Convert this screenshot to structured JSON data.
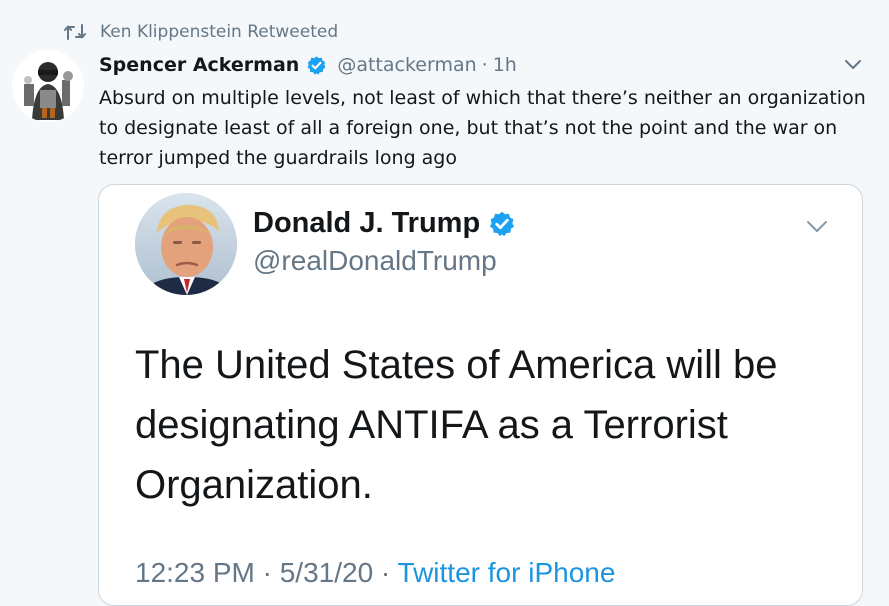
{
  "retweet_context": {
    "text": "Ken Klippenstein Retweeted",
    "icon": "retweet-icon"
  },
  "tweet": {
    "author_name": "Spencer Ackerman",
    "author_handle": "@attackerman",
    "separator": "·",
    "time": "1h",
    "text": "Absurd on multiple levels, not least of which that there’s neither an organization to designate least of all a foreign one, but that’s not the point and the war on terror jumped the guardrails long ago",
    "verified_icon": "verified-badge-icon",
    "menu_icon": "chevron-down-icon"
  },
  "embedded_tweet": {
    "author_name": "Donald J. Trump",
    "author_handle": "@realDonaldTrump",
    "text": "The United States of America will be designating ANTIFA as a Terrorist Organization.",
    "timestamp": "12:23 PM · 5/31/20 · ",
    "source": "Twitter for iPhone",
    "verified_icon": "verified-badge-icon",
    "menu_icon": "chevron-down-icon"
  },
  "colors": {
    "background": "#f5f8fa",
    "card_background": "#ffffff",
    "card_border": "#ccd6dd",
    "primary_text": "#14171a",
    "secondary_text": "#657786",
    "verified_blue": "#1da1f2",
    "link_blue": "#1b95e0"
  }
}
